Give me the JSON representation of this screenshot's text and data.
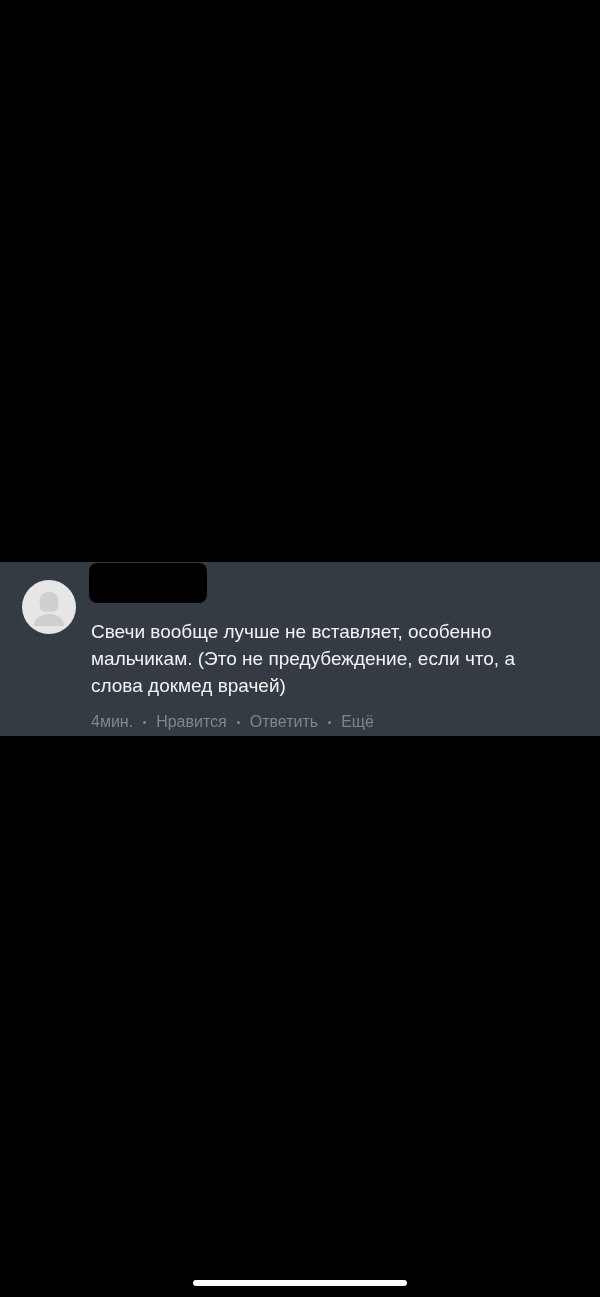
{
  "comment": {
    "author_redacted": true,
    "text": "Свечи вообще лучше не вставляет, особенно мальчикам. (Это не предубеждение, если что, а слова докмед врачей)",
    "time": "4мин.",
    "actions": [
      "Нравится",
      "Ответить",
      "Ещё"
    ]
  }
}
